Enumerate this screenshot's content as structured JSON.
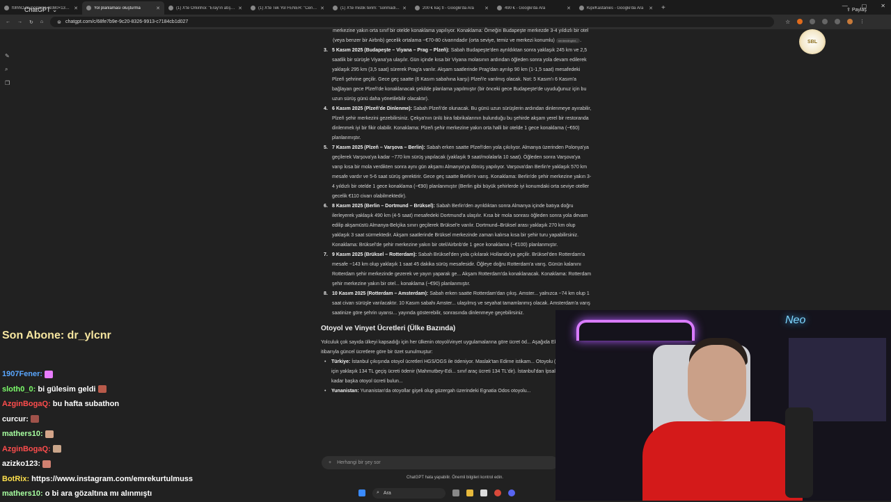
{
  "tabs": [
    {
      "title": "f0lhhOZ8.jpg(large (1080×1366)",
      "active": false
    },
    {
      "title": "Yol planlaması oluşturma",
      "active": true
    },
    {
      "title": "(1) X'te Orkinhoi: \"Eray'ın atıştı...",
      "active": false
    },
    {
      "title": "(1) X'te Tek Yol FENER: \"Cengiz...",
      "active": false
    },
    {
      "title": "(1) X'te mistik terim: \"sonmadı...",
      "active": false
    },
    {
      "title": "200 € kaç tl - Google'da Ara",
      "active": false
    },
    {
      "title": "490 € - Google'da Ara",
      "active": false
    },
    {
      "title": "Kipi/Kastanies - Google'da Ara",
      "active": false
    }
  ],
  "address": "chatgpt.com/c/68fe7b9e-9c20-8326-9913-c7184cb1d027",
  "model_label": "ChatGPT ⌄",
  "share_label": "Paylaş",
  "logo_text": "SBL",
  "intro_text": "merkezine yakın orta sınıf bir otelde konaklama yapılıyor. Konaklama: Örneğin Budapeşte merkezde 3-4 yıldızlı bir otel (veya benzer bir Airbnb) gecelik ortalama ~€70-80 civarındadır (orta seviye, temiz ve merkezi konumlu)",
  "chip_label": "nerdendingtixt...",
  "steps": [
    {
      "num": "3.",
      "title": "5 Kasım 2025 (Budapeşte – Viyana – Prag – Plzeň):",
      "text": "Sabah Budapeşte'den ayrıldıktan sonra yaklaşık 245 km ve 2,5 saatlik bir sürüşle Viyana'ya ulaşılır. Gün içinde kısa bir Viyana molasının ardından öğleden sonra yola devam edilerek yaklaşık 295 km (3,5 saat) sürerek Prag'a varılır. Akşam saatlerinde Prag'dan ayrılıp 90 km (1-1,5 saat) mesafedeki Plzeň şehrine geçilir. Gece geç saatte (6 Kasım sabahına karşı) Plzeň'e varılmış olacak. Not: 5 Kasım'ı 6 Kasım'a bağlayan gece Plzeň'de konaklanacak şekilde planlama yapılmıştır (bir önceki gece Budapeşte'de uyuduğunuz için bu uzun sürüş günü daha yönetilebilir olacaktır)."
    },
    {
      "num": "4.",
      "title": "6 Kasım 2025 (Plzeň'de Dinlenme):",
      "text": "Sabah Plzeň'de olunacak. Bu günü uzun sürüşlerin ardından dinlenmeye ayırabilir, Plzeň şehir merkezini gezebilirsiniz. Çekya'nın ünlü bira fabrikalarının bulunduğu bu şehirde akşam yerel bir restoranda dinlenmek iyi bir fikir olabilir. Konaklama: Plzeň şehir merkezine yakın orta halli bir otelde 1 gece konaklama (~€60) planlanmıştır."
    },
    {
      "num": "5.",
      "title": "7 Kasım 2025 (Plzeň – Varşova – Berlin):",
      "text": "Sabah erken saatte Plzeň'den yola çıkılıyor. Almanya üzerinden Polonya'ya geçilerek Varşova'ya kadar ~770 km sürüş yapılacak (yaklaşık 9 saat/molalarla 10 saat). Öğleden sonra Varşova'ya varıp kısa bir mola verdikten sonra aynı gün akşamı Almanya'ya dönüş yapılıyor. Varşova'dan Berlin'e yaklaşık 570 km mesafe vardır ve 5-6 saat sürüş gerektirir. Gece geç saatte Berlin'e varış. Konaklama: Berlin'de şehir merkezine yakın 3-4 yıldızlı bir otelde 1 gece konaklama (~€90) planlanmıştır (Berlin gibi büyük şehirlerde iyi konumdaki orta seviye oteller gecelik €110 civarı olabilmektedir)."
    },
    {
      "num": "6.",
      "title": "8 Kasım 2025 (Berlin – Dortmund – Brüksel):",
      "text": "Sabah Berlin'den ayrıldıktan sonra Almanya içinde batıya doğru ilerleyerek yaklaşık 490 km (4-5 saat) mesafedeki Dortmund'a ulaşılır. Kısa bir mola sonrası öğleden sonra yola devam edilip akşamüstü Almanya-Belçika sınırı geçilerek Brüksel'e varılır. Dortmund–Brüksel arası yaklaşık 270 km olup yaklaşık 3 saat sürmektedir. Akşam saatlerinde Brüksel merkezinde zaman kalırsa kısa bir şehir turu yapabilirsiniz. Konaklama: Brüksel'de şehir merkezine yakın bir otel/Airbnb'de 1 gece konaklama (~€100) planlanmıştır."
    },
    {
      "num": "7.",
      "title": "9 Kasım 2025 (Brüksel – Rotterdam):",
      "text": "Sabah Brüksel'den yola çıkılarak Hollanda'ya geçilir. Brüksel'den Rotterdam'a mesafe ~143 km olup yaklaşık 1 saat 45 dakika sürüş mesafesidir. Öğleye doğru Rotterdam'a varış. Günün kalanını Rotterdam şehir merkezinde gezerek ve yayın yaparak ge... Akşam Rotterdam'da konaklanacak. Konaklama: Rotterdam şehir merkezine yakın bir otel... konaklama (~€90) planlanmıştır."
    },
    {
      "num": "8.",
      "title": "10 Kasım 2025 (Rotterdam – Amsterdam):",
      "text": "Sabah erken saatte Rotterdam'dan çıkış. Amster... yalnızca ~74 km olup 1 saat civarı sürüşle varılacaktır. 10 Kasım sabahı Amster... ulaşılmış ve seyahat tamamlanmış olacak. Amsterdam'a varış saatinize göre şehrin uyarısı... yayında gösterebilir, sonrasında dinlenmeye geçebilirsiniz."
    }
  ],
  "section_heading": "Otoyol ve Vinyet Ücretleri (Ülke Bazında)",
  "section_intro": "Yolculuk çok sayıda ülkeyi kapsadığı için her ülkenin otoyol/vinyet uygulamalarına göre ücret öd... Aşağıda Ekim 2025 itibarıyla güncel ücretlere göre bir özet sunulmuştur:",
  "bullets": [
    {
      "label": "Türkiye:",
      "text": "İstanbul çıkışında otoyol ücretleri HGS/OGS ile ödeniyor. Maslak'tan Edirne istikam... Otoyolu (O-3) kullanımı için yaklaşık 134 TL geçiş ücreti ödenir (Mahmutbey-Edi... sınıf araç ücreti 134 TL'dir). İstanbul'dan İpsala sı... apısına kadar başka otoyol ücreti bulun..."
    },
    {
      "label": "Yunanistan:",
      "text": "Yunanistan'da otoyollar gişeli olup güzergah üzerindeki Egnatia Odos otoyolu..."
    }
  ],
  "composer_placeholder": "Herhangi bir şey sor",
  "composer_plus": "+",
  "disclaimer": "ChatGPT hata yapabilir. Önemli bilgileri kontrol edin.",
  "taskbar_search": "Ara",
  "sub_banner": "Son Abone: dr_ylcnr",
  "chat": [
    {
      "user": "1907Fener:",
      "user_color": "#5aa7ff",
      "message": "",
      "emote_color": "#e87cff"
    },
    {
      "user": "sloth0_0:",
      "user_color": "#7dff6b",
      "message": "bi gülesim geldi",
      "emote_color": "#b85a4a"
    },
    {
      "user": "AzginBogaQ:",
      "user_color": "#ff4d4d",
      "message": "bu hafta subathon",
      "emote_color": ""
    },
    {
      "user": "curcur:",
      "user_color": "#ffffff",
      "message": "",
      "emote_color": "#a0524a"
    },
    {
      "user": "mathers10:",
      "user_color": "#a7ffa0",
      "message": "",
      "emote_color": "#d4a58a"
    },
    {
      "user": "AzginBogaQ:",
      "user_color": "#ff4d4d",
      "message": "",
      "emote_color": "#c9a58a"
    },
    {
      "user": "azizko123:",
      "user_color": "#ffffff",
      "message": "",
      "emote_color": "#d08070"
    },
    {
      "user": "BotRix:",
      "user_color": "#ffe14d",
      "message": "https://www.instagram.com/emrekurtulmuss",
      "emote_color": ""
    },
    {
      "user": "mathers10:",
      "user_color": "#a7ffa0",
      "message": "o bi ara gözaltına mı alınmıştı",
      "emote_color": ""
    }
  ],
  "webcam_neon": "Neo",
  "colors": {
    "bg": "#212121",
    "text": "#d6d6d6",
    "sub_banner": "#f6e6a0"
  }
}
